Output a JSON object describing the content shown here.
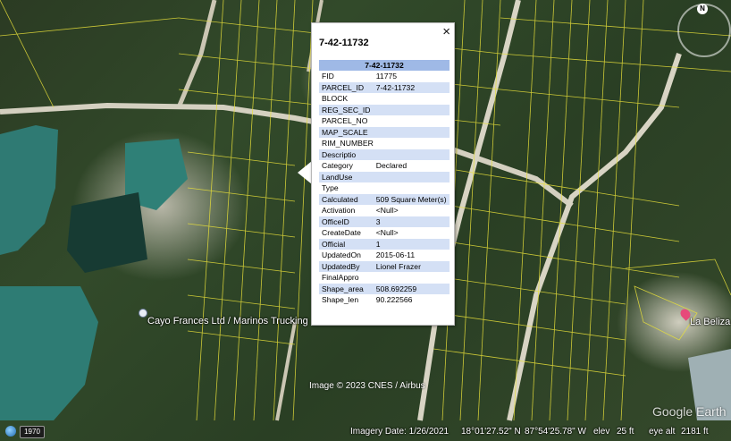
{
  "balloon": {
    "title": "7-42-11732",
    "table_header": "7-42-11732",
    "close_label": "×",
    "rows": [
      {
        "key": "FID",
        "value": "11775"
      },
      {
        "key": "PARCEL_ID",
        "value": "7-42-11732"
      },
      {
        "key": "BLOCK",
        "value": ""
      },
      {
        "key": "REG_SEC_ID",
        "value": ""
      },
      {
        "key": "PARCEL_NO",
        "value": ""
      },
      {
        "key": "MAP_SCALE",
        "value": ""
      },
      {
        "key": "RIM_NUMBER",
        "value": ""
      },
      {
        "key": "Descriptio",
        "value": ""
      },
      {
        "key": "Category",
        "value": "Declared"
      },
      {
        "key": "LandUse",
        "value": ""
      },
      {
        "key": "Type",
        "value": ""
      },
      {
        "key": "Calculated",
        "value": "509 Square Meter(s)"
      },
      {
        "key": "Activation",
        "value": "<Null>"
      },
      {
        "key": "OfficeID",
        "value": "3"
      },
      {
        "key": "CreateDate",
        "value": "<Null>"
      },
      {
        "key": "Official",
        "value": "1"
      },
      {
        "key": "UpdatedOn",
        "value": "2015-06-11"
      },
      {
        "key": "UpdatedBy",
        "value": "Lionel Frazer"
      },
      {
        "key": "FinalAppro",
        "value": ""
      },
      {
        "key": "Shape_area",
        "value": "508.692259"
      },
      {
        "key": "Shape_len",
        "value": "90.222566"
      }
    ]
  },
  "map": {
    "place_label": "Cayo Frances Ltd / Marinos Trucking",
    "place_label_2": "La Beliza",
    "image_credit": "Image © 2023 CNES / Airbus",
    "watermark": "Google Earth",
    "compass_letter": "N",
    "pin_icon": "placemark-pin-icon",
    "red_pin_icon": "red-placemark-icon"
  },
  "status": {
    "year_label": "1970",
    "imagery_date": "Imagery Date: 1/26/2021",
    "latitude": "18°01'27.52\" N",
    "longitude": "87°54'25.78\" W",
    "elev_label": "elev",
    "elev_value": "25 ft",
    "eye_alt_label": "eye alt",
    "eye_alt_value": "2181 ft"
  },
  "colors": {
    "table_header": "#9fb9e6",
    "table_alt_row": "#d4e0f5",
    "parcel_lines": "#e8e03a",
    "road": "#d9d6c8",
    "water": "#1f6a5e"
  }
}
